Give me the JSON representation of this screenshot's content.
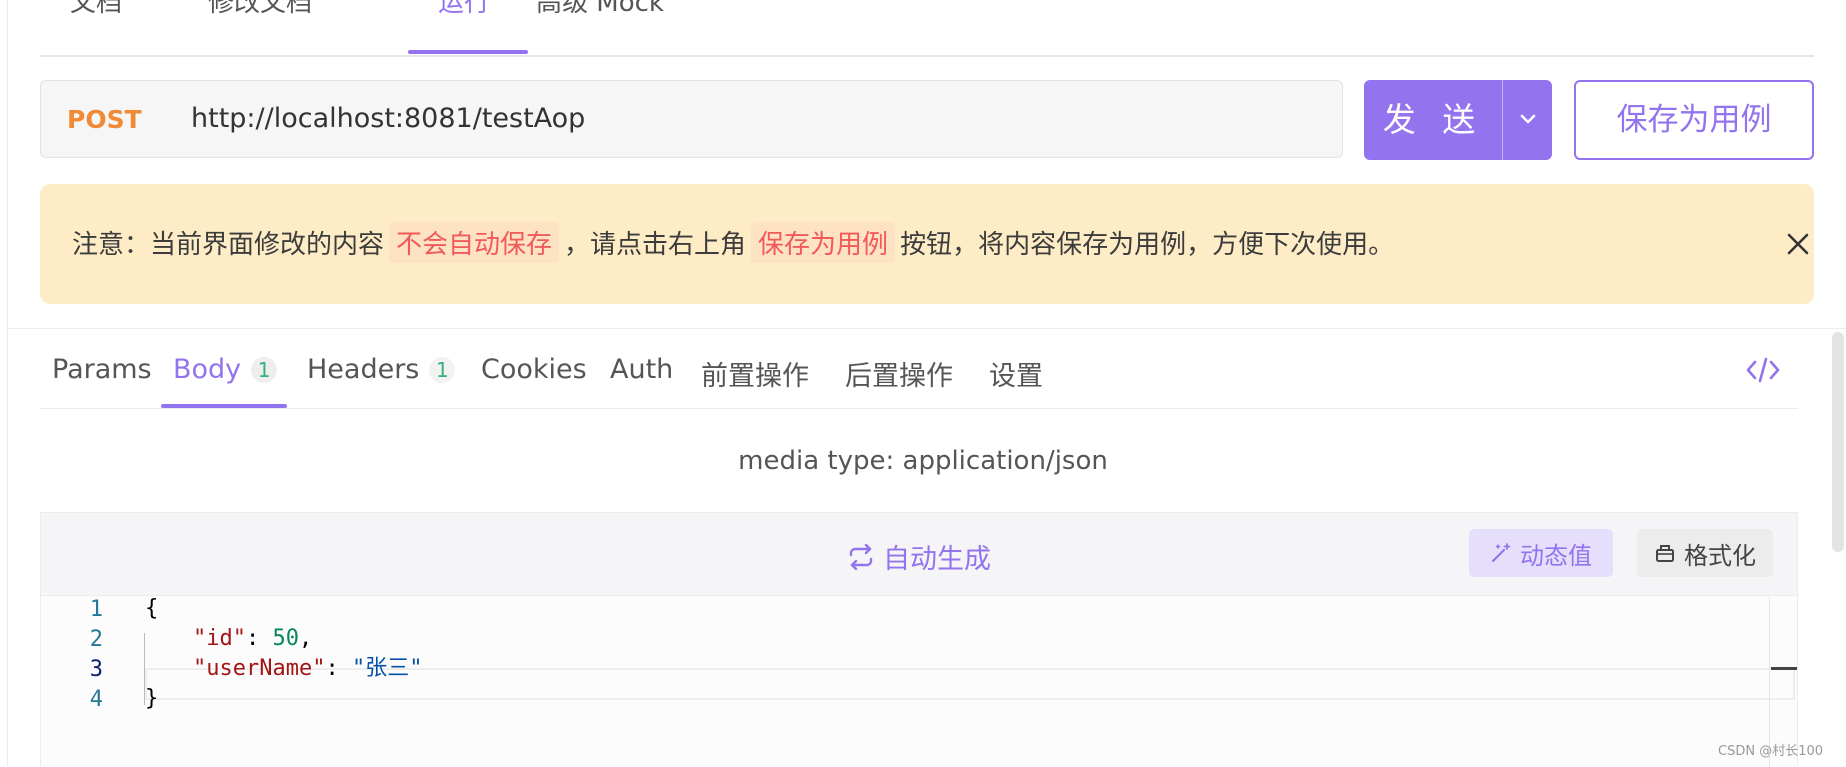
{
  "top_tabs": [
    {
      "label": "文档"
    },
    {
      "label": "修改文档"
    },
    {
      "label": "运行",
      "active": true
    },
    {
      "label": "高级 Mock"
    }
  ],
  "request": {
    "method": "POST",
    "url": "http://localhost:8081/testAop",
    "send_label": "发 送",
    "save_case_label": "保存为用例"
  },
  "notice": {
    "prefix": "注意：当前界面修改的内容",
    "highlight1": "不会自动保存",
    "middle": "，请点击右上角",
    "highlight2": "保存为用例",
    "suffix": "按钮，将内容保存为用例，方便下次使用。"
  },
  "body_tabs": [
    {
      "label": "Params"
    },
    {
      "label": "Body",
      "count": "1",
      "active": true
    },
    {
      "label": "Headers",
      "count": "1"
    },
    {
      "label": "Cookies"
    },
    {
      "label": "Auth"
    },
    {
      "label": "前置操作"
    },
    {
      "label": "后置操作"
    },
    {
      "label": "设置"
    }
  ],
  "media_type": "media type: application/json",
  "editor": {
    "autogen_label": "自动生成",
    "dynamic_value_label": "动态值",
    "format_label": "格式化",
    "line_numbers": [
      "1",
      "2",
      "3",
      "4"
    ],
    "lines": {
      "l1": "{",
      "l2_key": "\"id\"",
      "l2_sep": ": ",
      "l2_val": "50",
      "l2_end": ",",
      "l3_key": "\"userName\"",
      "l3_sep": ": ",
      "l3_val": "\"张三\"",
      "l4": "}"
    }
  },
  "watermark": "CSDN @村长100",
  "colors": {
    "accent": "#9373ee",
    "method_post": "#f08a35",
    "notice_bg": "#fdecc6",
    "highlight_text": "#f25a5a",
    "count_text": "#35b07a"
  }
}
